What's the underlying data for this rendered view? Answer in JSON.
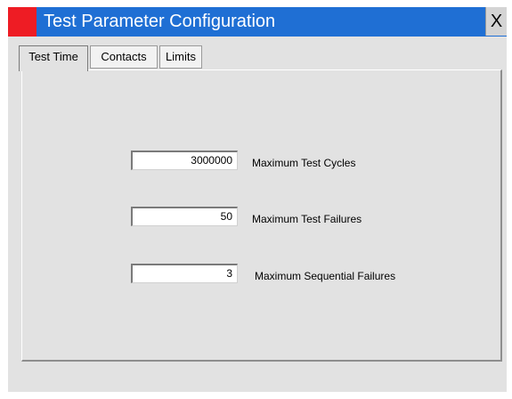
{
  "window": {
    "title": "Test Parameter Configuration",
    "close_label": "X"
  },
  "tabs": [
    {
      "label": "Test Time",
      "active": true
    },
    {
      "label": "Contacts",
      "active": false
    },
    {
      "label": "Limits",
      "active": false
    }
  ],
  "fields": {
    "max_test_cycles": {
      "value": "3000000",
      "label": "Maximum Test Cycles"
    },
    "max_test_failures": {
      "value": "50",
      "label": "Maximum Test Failures"
    },
    "max_sequential_failures": {
      "value": "3",
      "label": "Maximum Sequential Failures"
    }
  },
  "colors": {
    "titlebar": "#1f6fd4",
    "app_icon": "#ee1c24",
    "background": "#e2e2e2"
  }
}
